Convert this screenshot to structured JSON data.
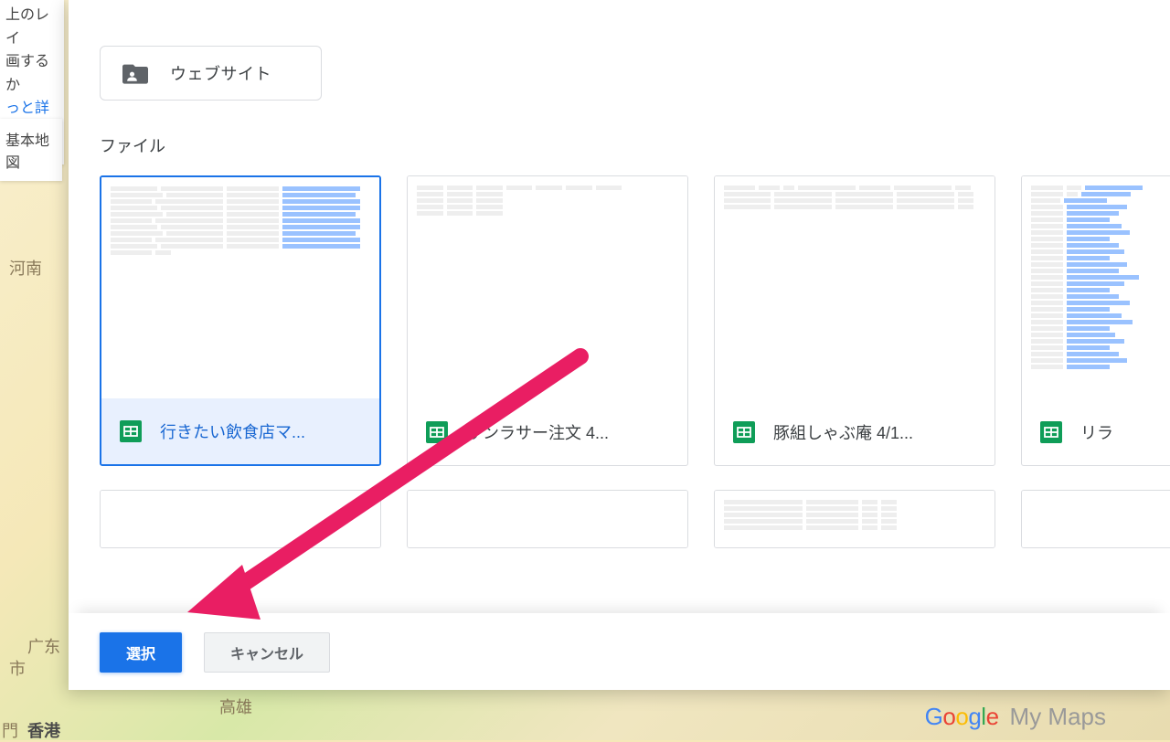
{
  "sidebar_fragment": {
    "line1": "上のレイ",
    "line2": "画するか",
    "link_text": "っと詳し"
  },
  "basemap_fragment": "基本地図",
  "folder": {
    "label": "ウェブサイト"
  },
  "section_title": "ファイル",
  "files": [
    {
      "name": "行きたい飲食店マ...",
      "selected": true
    },
    {
      "name": "サンラサー注文 4...",
      "selected": false
    },
    {
      "name": "豚組しゃぶ庵 4/1...",
      "selected": false
    },
    {
      "name": "リラ",
      "selected": false
    }
  ],
  "buttons": {
    "select": "選択",
    "cancel": "キャンセル"
  },
  "map_labels": {
    "henan": "河南",
    "guangdong": "广东",
    "shi": "市",
    "men": "門",
    "hongkong": "香港",
    "gaoxiong": "高雄"
  },
  "watermark": {
    "google": "Google",
    "mymaps": "My Maps"
  }
}
